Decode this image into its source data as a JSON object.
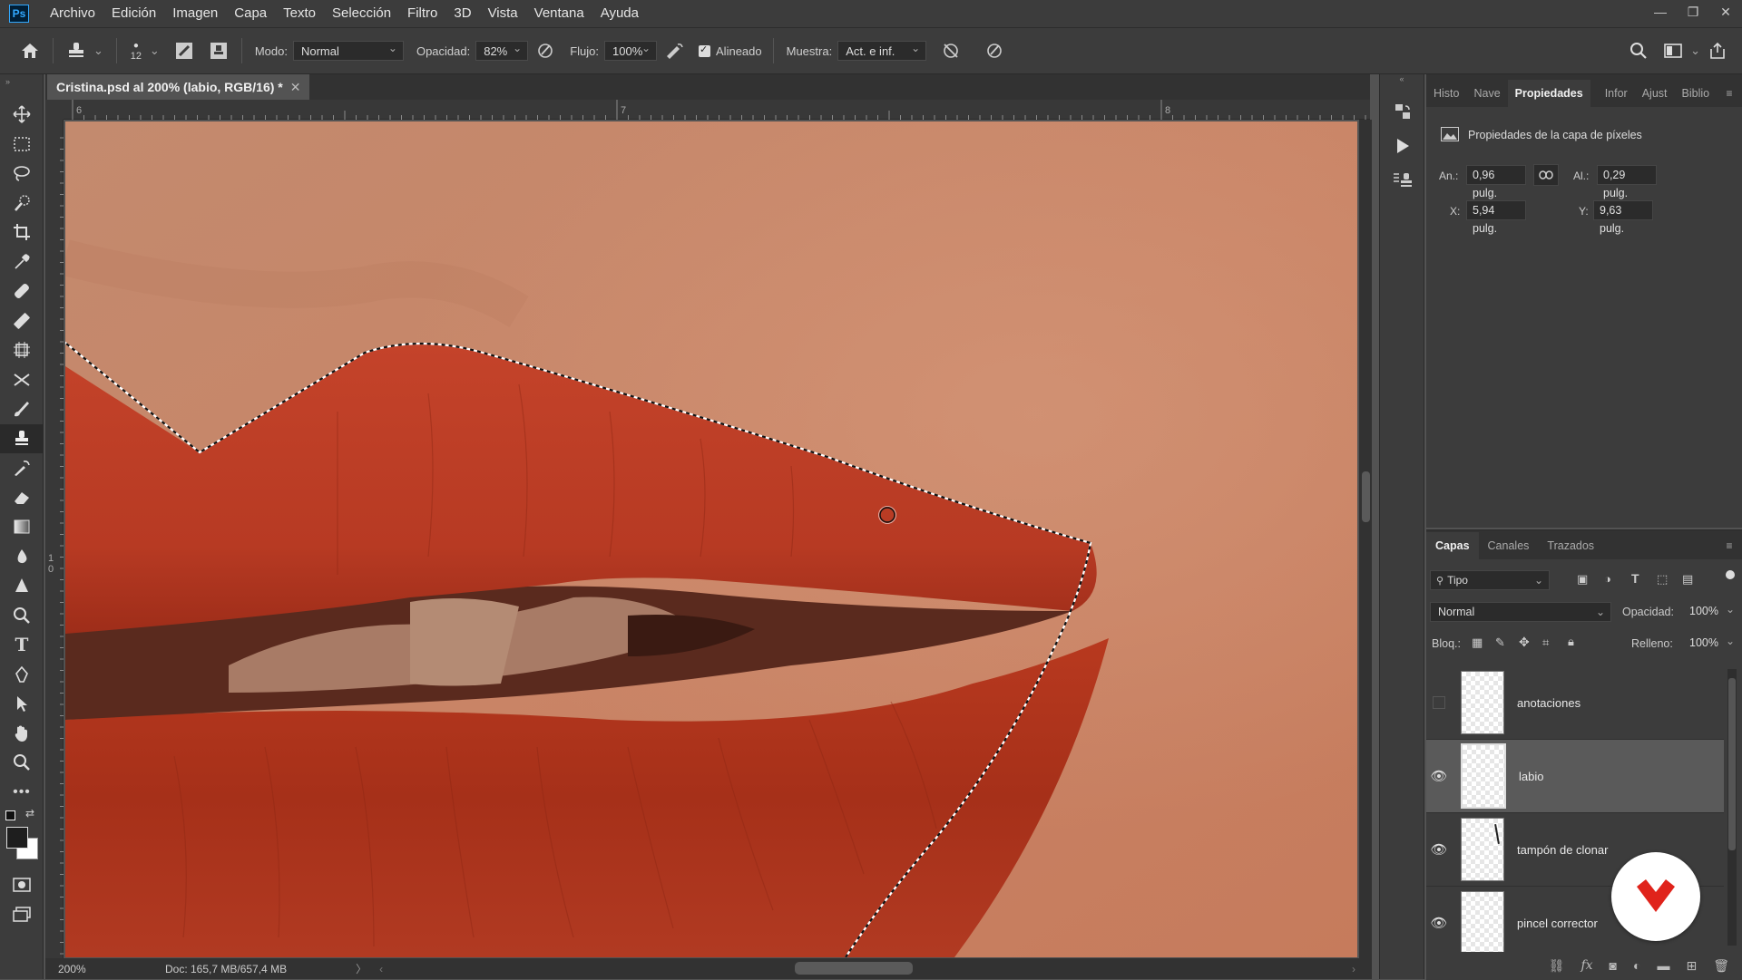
{
  "app": {
    "logo": "Ps"
  },
  "menu": [
    "Archivo",
    "Edición",
    "Imagen",
    "Capa",
    "Texto",
    "Selección",
    "Filtro",
    "3D",
    "Vista",
    "Ventana",
    "Ayuda"
  ],
  "options": {
    "brush_size": "12",
    "mode_label": "Modo:",
    "mode_value": "Normal",
    "opacity_label": "Opacidad:",
    "opacity_value": "82%",
    "flow_label": "Flujo:",
    "flow_value": "100%",
    "aligned_label": "Alineado",
    "sample_label": "Muestra:",
    "sample_value": "Act. e inf."
  },
  "document": {
    "tab_title": "Cristina.psd al 200% (labio, RGB/16) *",
    "ruler_top": [
      "6",
      "7",
      "8"
    ],
    "ruler_left": [
      "1",
      "0"
    ],
    "zoom": "200%",
    "doc_info": "Doc: 165,7 MB/657,4 MB"
  },
  "properties": {
    "tabs": [
      "Histo",
      "Nave",
      "Propiedades",
      "Infor",
      "Ajust",
      "Biblio"
    ],
    "active_tab": "Propiedades",
    "heading": "Propiedades de la capa de píxeles",
    "width_label": "An.:",
    "width_value": "0,96 pulg.",
    "height_label": "Al.:",
    "height_value": "0,29 pulg.",
    "x_label": "X:",
    "x_value": "5,94 pulg.",
    "y_label": "Y:",
    "y_value": "9,63 pulg."
  },
  "layers_panel": {
    "tabs": [
      "Capas",
      "Canales",
      "Trazados"
    ],
    "active_tab": "Capas",
    "filter_value": "Tipo",
    "blend_mode": "Normal",
    "opacity_label": "Opacidad:",
    "opacity_value": "100%",
    "lock_label": "Bloq.:",
    "fill_label": "Relleno:",
    "fill_value": "100%",
    "layers": [
      {
        "name": "anotaciones",
        "visible": false,
        "selected": false
      },
      {
        "name": "labio",
        "visible": true,
        "selected": true
      },
      {
        "name": "tampón de clonar",
        "visible": true,
        "selected": false
      },
      {
        "name": "pincel corrector",
        "visible": true,
        "selected": false
      }
    ]
  },
  "colors": {
    "accent": "#31a8ff",
    "panel_bg": "#3c3c3c",
    "canvas_skin": "#c98466",
    "lip": "#b33a22",
    "badge_red": "#e0231b"
  }
}
